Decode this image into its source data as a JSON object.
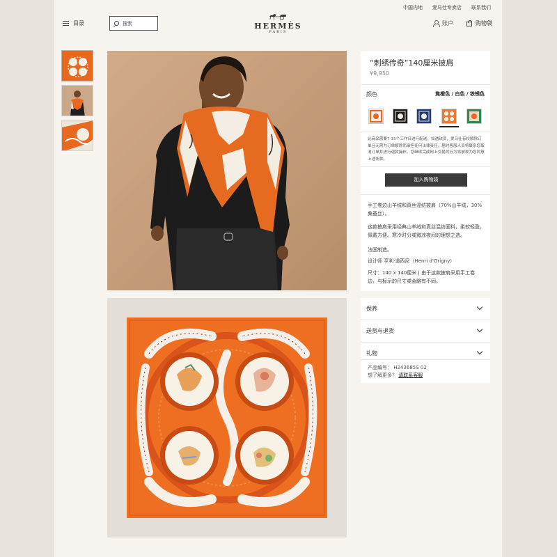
{
  "utility_bar": [
    "中国内地",
    "爱马仕专卖店",
    "联系我们"
  ],
  "header": {
    "menu_label": "目录",
    "search_placeholder": "搜索",
    "logo_name": "HERMÈS",
    "logo_sub": "PARIS",
    "account_label": "账户",
    "cart_label": "购物袋"
  },
  "product": {
    "title": "“刺绣传奇”140厘米披肩",
    "price": "¥9,950",
    "color_label": "颜色",
    "color_value": "焦橙色 / 白色 / 铁锈色",
    "swatches": [
      "#e9681f",
      "#2c3a66",
      "#1f3a78",
      "#e87c34",
      "#2e8a52"
    ],
    "notice": "此商品需要7-15个工作日进行配送。如遇缺货，爱马仕有权解除订单且无需为订单解除而承担任何法律责任。届时客服人员将联系您取消订单并进行退款操作。您继续完成网上交易的行为将被视为您同意上述条款。",
    "add_to_bag": "加入购物袋",
    "desc_1": "手工卷边山羊绒和真丝混纺披肩（70%山羊绒，30%桑蚕丝）。",
    "desc_2": "这款披肩采用经典山羊绒和真丝混纺面料，柔软轻盈，佩戴方便。寒冷时分或微凉夜间的理想之选。",
    "desc_3": "法国制造。",
    "desc_4": "设计师 亨利·道西尼（Henri d'Origny）",
    "desc_5": "尺寸：140 x 140厘米 | 由于这款披肩采用手工卷边，与标示的尺寸或会略有不同。"
  },
  "accordion": {
    "items": [
      "保养",
      "送货与退货",
      "礼物"
    ],
    "product_code_label": "产品编号：",
    "product_code": "H243685S 02",
    "contact_prefix": "想了解更多？",
    "contact_link": "请联系客服"
  },
  "colors": {
    "accent_orange": "#e9681f",
    "button_dark": "#3a3a3a",
    "page_bg": "#f7f3ef"
  }
}
